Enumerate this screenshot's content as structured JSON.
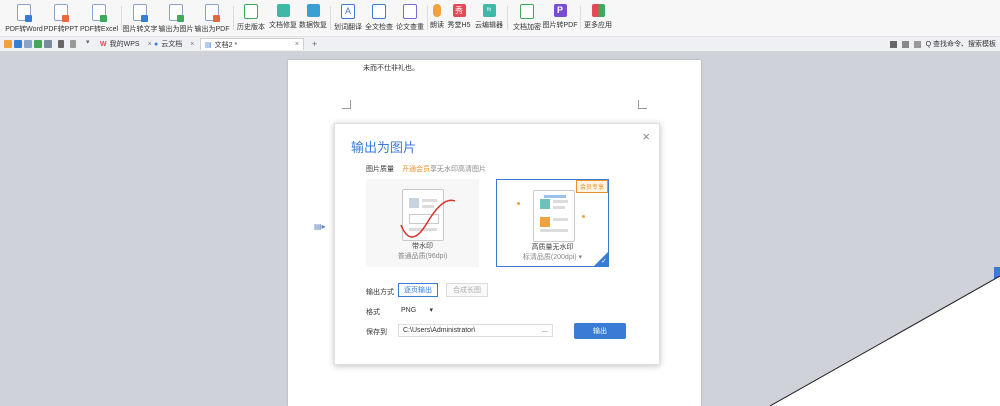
{
  "ribbon": {
    "items": [
      {
        "label": "PDF转Word",
        "icon": "pdf-to-word-icon"
      },
      {
        "label": "PDF转PPT",
        "icon": "pdf-to-ppt-icon"
      },
      {
        "label": "PDF转Excel",
        "icon": "pdf-to-excel-icon"
      },
      {
        "label": "图片转文字",
        "icon": "image-to-text-icon"
      },
      {
        "label": "输出为图片",
        "icon": "export-image-icon"
      },
      {
        "label": "输出为PDF",
        "icon": "export-pdf-icon"
      },
      {
        "label": "历史版本",
        "icon": "history-icon"
      },
      {
        "label": "文档修复",
        "icon": "doc-repair-icon"
      },
      {
        "label": "数据恢复",
        "icon": "data-recovery-icon"
      },
      {
        "label": "划词翻译",
        "icon": "translate-icon"
      },
      {
        "label": "全文检查",
        "icon": "check-icon"
      },
      {
        "label": "论文查重",
        "icon": "paper-check-icon"
      },
      {
        "label": "朗读",
        "icon": "read-aloud-icon"
      },
      {
        "label": "秀堂H5",
        "icon": "h5-icon"
      },
      {
        "label": "云编辑器",
        "icon": "cloud-editor-icon"
      },
      {
        "label": "文档加密",
        "icon": "encrypt-icon"
      },
      {
        "label": "图片转PDF",
        "icon": "image-to-pdf-icon"
      },
      {
        "label": "更多应用",
        "icon": "more-apps-icon"
      }
    ],
    "icon_glyphs": {
      "translate": "A",
      "h5": "秀",
      "cloud_editor": "fit",
      "image_to_pdf": "P"
    }
  },
  "tabs": [
    {
      "label": "我的WPS"
    },
    {
      "label": "云文档"
    },
    {
      "label": "文档2 *"
    }
  ],
  "tab_add": "+",
  "tab_close": "×",
  "search": {
    "label": "Q 查找命令、搜索模板"
  },
  "document": {
    "text": "未而不仕非礼也。"
  },
  "dialog": {
    "title": "输出为图片",
    "close": "×",
    "quality_label": "图片质量",
    "vip_link": "开通会员",
    "vip_note": "享无水印高清图片",
    "option1": {
      "title": "带水印",
      "subtitle": "普通品质(96dpi)"
    },
    "option2": {
      "title": "高质量无水印",
      "subtitle": "标清品质(200dpi)",
      "badge": "会员专享"
    },
    "output_mode_label": "输出方式",
    "mode_single": "逐页输出",
    "mode_long": "合成长图",
    "format_label": "格式",
    "format_value": "PNG",
    "save_label": "保存到",
    "save_path": "C:\\Users\\Administrator\\",
    "browse": "...",
    "export_label": "输出"
  },
  "colors": {
    "accent": "#3a7bd5",
    "vip": "#e8902c"
  }
}
